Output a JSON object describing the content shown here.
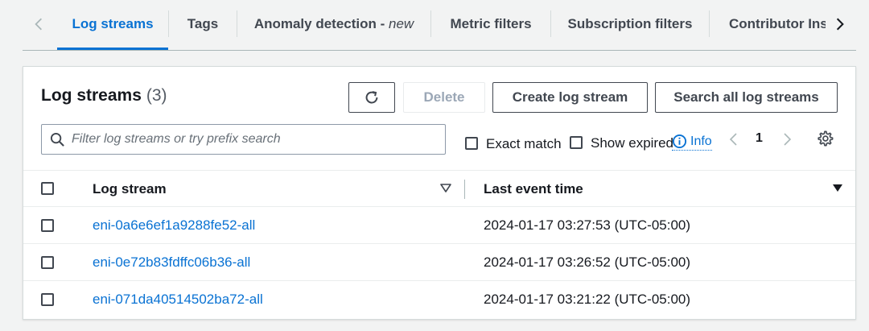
{
  "tabs": [
    {
      "label": "Log streams",
      "active": true
    },
    {
      "label": "Tags"
    },
    {
      "label": "Anomaly detection - ",
      "suffix": "new"
    },
    {
      "label": "Metric filters"
    },
    {
      "label": "Subscription filters"
    },
    {
      "label": "Contributor Ins"
    }
  ],
  "panel": {
    "title": "Log streams",
    "count": "(3)"
  },
  "buttons": {
    "refresh_icon": "refresh-icon",
    "delete": "Delete",
    "create": "Create log stream",
    "search_all": "Search all log streams"
  },
  "search": {
    "placeholder": "Filter log streams or try prefix search",
    "value": ""
  },
  "options": {
    "exact_match": "Exact match",
    "show_expired": "Show expired",
    "info": "Info"
  },
  "pagination": {
    "current_page": "1"
  },
  "table": {
    "columns": [
      "Log stream",
      "Last event time"
    ],
    "rows": [
      {
        "stream": "eni-0a6e6ef1a9288fe52-all",
        "time": "2024-01-17 03:27:53 (UTC-05:00)"
      },
      {
        "stream": "eni-0e72b83fdffc06b36-all",
        "time": "2024-01-17 03:26:52 (UTC-05:00)"
      },
      {
        "stream": "eni-071da40514502ba72-all",
        "time": "2024-01-17 03:21:22 (UTC-05:00)"
      }
    ]
  },
  "colors": {
    "accent": "#0972d3",
    "text": "#16191f",
    "border": "#414750"
  }
}
